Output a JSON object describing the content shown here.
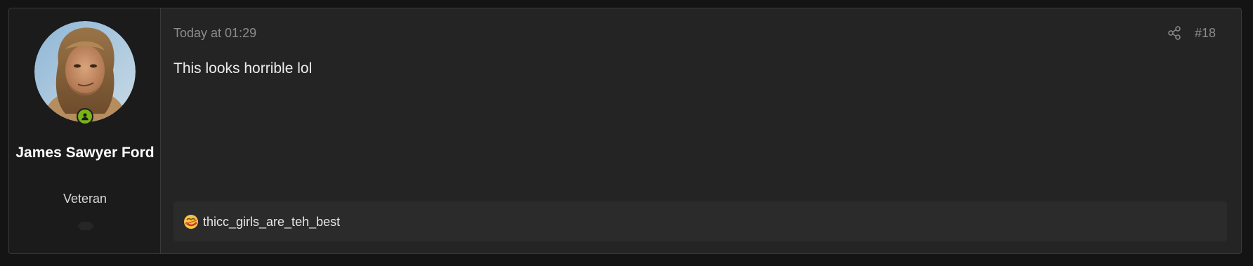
{
  "post": {
    "timestamp": "Today at 01:29",
    "post_number": "#18",
    "message": "This looks horrible lol",
    "share_icon": "share-icon"
  },
  "author": {
    "name": "James Sawyer Ford",
    "title": "Veteran",
    "online_status_icon": "online-user-icon",
    "status_color": "#7ab317"
  },
  "signature": {
    "emoji_icon": "dizzy-face-emoji",
    "text": "thicc_girls_are_teh_best"
  },
  "colors": {
    "page_background": "#141414",
    "post_background": "#242424",
    "user_cell_background": "#1b1b1b",
    "signature_background": "#2b2b2b",
    "muted_text": "#8c8c8c"
  }
}
